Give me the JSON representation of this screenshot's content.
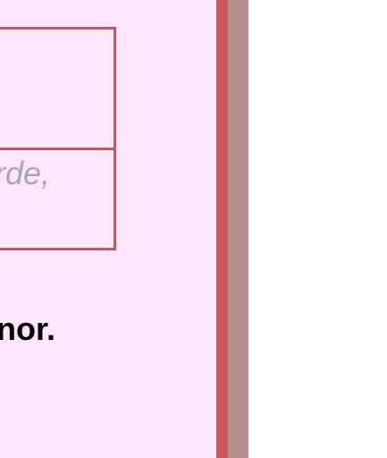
{
  "content": {
    "row_text": "rde,",
    "bottom_text": "nor."
  },
  "colors": {
    "panel_background": "#ffe6fd",
    "border": "#c9555d",
    "muted_text": "#a8a8ad",
    "scrollbar": "#b39090"
  }
}
